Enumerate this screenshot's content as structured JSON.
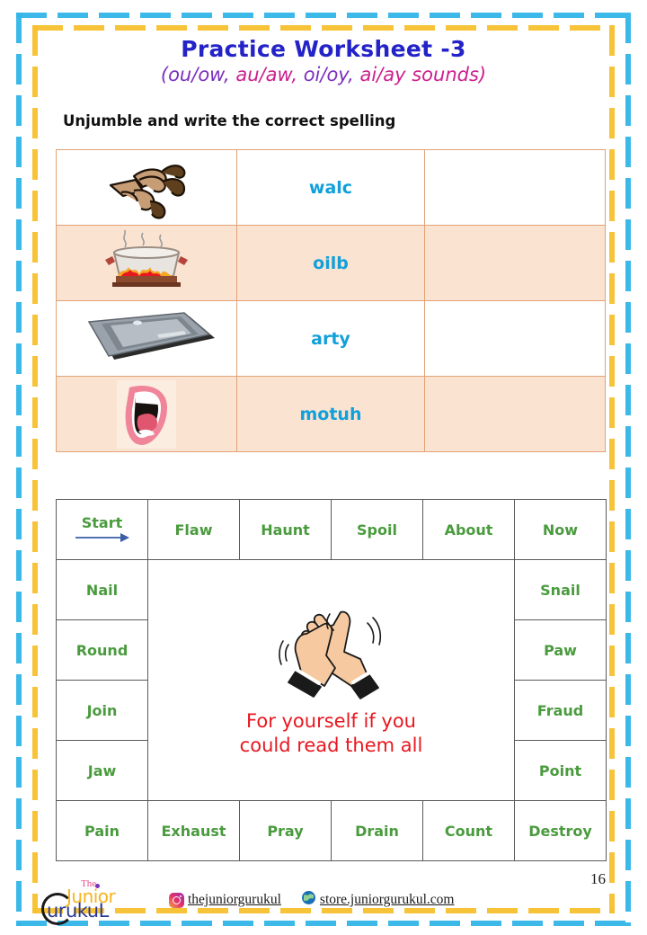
{
  "header": {
    "title": "Practice Worksheet -3",
    "subtitle_parts": [
      {
        "text": "(ou/ow,",
        "color": "#7b2fbe"
      },
      {
        "text": "au/aw,",
        "color": "#cc1f8d"
      },
      {
        "text": "oi/oy,",
        "color": "#7b2fbe"
      },
      {
        "text": "ai/ay sounds)",
        "color": "#cc1f8d"
      }
    ],
    "title_color": "#2323c8"
  },
  "instruction": "Unjumble and write the correct spelling",
  "unjumble_table": {
    "rows": [
      {
        "picture": "claw-icon",
        "jumbled": "walc",
        "answer": "",
        "tinted": false
      },
      {
        "picture": "boiling-pot-icon",
        "jumbled": "oilb",
        "answer": "",
        "tinted": true
      },
      {
        "picture": "tray-icon",
        "jumbled": "arty",
        "answer": "",
        "tinted": false
      },
      {
        "picture": "open-mouth-icon",
        "jumbled": "motuh",
        "answer": "",
        "tinted": true
      }
    ],
    "word_color": "#11a0da",
    "border_color": "#e2a277",
    "tint_color": "#fbe3d2"
  },
  "board": {
    "start_label": "Start",
    "top_row": [
      "Flaw",
      "Haunt",
      "Spoil",
      "About",
      "Now"
    ],
    "left_column": [
      "Nail",
      "Round",
      "Join",
      "Jaw"
    ],
    "right_column": [
      "Snail",
      "Paw",
      "Fraud",
      "Point"
    ],
    "bottom_row": [
      "Pain",
      "Exhaust",
      "Pray",
      "Drain",
      "Count",
      "Destroy"
    ],
    "center_image": "clapping-hands-icon",
    "center_text_line1": "For yourself if you",
    "center_text_line2": "could read them all",
    "word_color": "#4a9b3e",
    "center_text_color": "#e8171f",
    "arrow_color": "#3a5fa8"
  },
  "footer": {
    "logo": {
      "the": "The",
      "junior": "Junior",
      "gurukul": "urukuL"
    },
    "instagram_handle": "thejuniorgurukul",
    "website": "store.juniorgurukul.com",
    "instagram_icon": "instagram-icon",
    "website_icon": "globe-icon"
  },
  "page_number": "16"
}
